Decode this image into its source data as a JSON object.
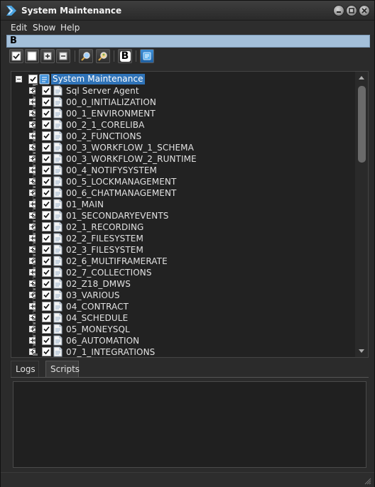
{
  "window": {
    "title": "System Maintenance",
    "accent": "#2f73b8"
  },
  "menu": {
    "items": [
      "Edit",
      "Show",
      "Help"
    ]
  },
  "strip": {
    "badge": "B"
  },
  "toolbar": {
    "buttons": [
      {
        "icon": "check-all-icon"
      },
      {
        "icon": "uncheck-all-icon"
      },
      {
        "icon": "expand-all-icon"
      },
      {
        "icon": "collapse-all-icon"
      },
      {
        "icon": "search-icon"
      },
      {
        "icon": "search-user-icon"
      },
      {
        "icon": "b-badge-icon",
        "label": "B"
      },
      {
        "icon": "run-script-icon"
      }
    ]
  },
  "tree": {
    "root": {
      "label": "System Maintenance",
      "checked": true,
      "expanded": true,
      "selected": true
    },
    "items": [
      {
        "label": "Sql Server Agent",
        "checked": true
      },
      {
        "label": "00_0_INITIALIZATION",
        "checked": true
      },
      {
        "label": "00_1_ENVIRONMENT",
        "checked": true
      },
      {
        "label": "00_2_1_CORELIBA",
        "checked": true
      },
      {
        "label": "00_2_FUNCTIONS",
        "checked": true
      },
      {
        "label": "00_3_WORKFLOW_1_SCHEMA",
        "checked": true
      },
      {
        "label": "00_3_WORKFLOW_2_RUNTIME",
        "checked": true
      },
      {
        "label": "00_4_NOTIFYSYSTEM",
        "checked": true
      },
      {
        "label": "00_5_LOCKMANAGEMENT",
        "checked": true
      },
      {
        "label": "00_6_CHATMANAGEMENT",
        "checked": true
      },
      {
        "label": "01_MAIN",
        "checked": true
      },
      {
        "label": "01_SECONDARYEVENTS",
        "checked": true
      },
      {
        "label": "02_1_RECORDING",
        "checked": true
      },
      {
        "label": "02_2_FILESYSTEM",
        "checked": true
      },
      {
        "label": "02_3_FILESYSTEM",
        "checked": true
      },
      {
        "label": "02_6_MULTIFRAMERATE",
        "checked": true
      },
      {
        "label": "02_7_COLLECTIONS",
        "checked": true
      },
      {
        "label": "02_Z18_DMWS",
        "checked": true
      },
      {
        "label": "03_VARIOUS",
        "checked": true
      },
      {
        "label": "04_CONTRACT",
        "checked": true
      },
      {
        "label": "04_SCHEDULE",
        "checked": true
      },
      {
        "label": "05_MONEYSQL",
        "checked": true
      },
      {
        "label": "06_AUTOMATION",
        "checked": true
      },
      {
        "label": "07_1_INTEGRATIONS",
        "checked": true
      }
    ]
  },
  "tabs": [
    "Logs",
    "Scripts"
  ],
  "active_tab": "Scripts"
}
